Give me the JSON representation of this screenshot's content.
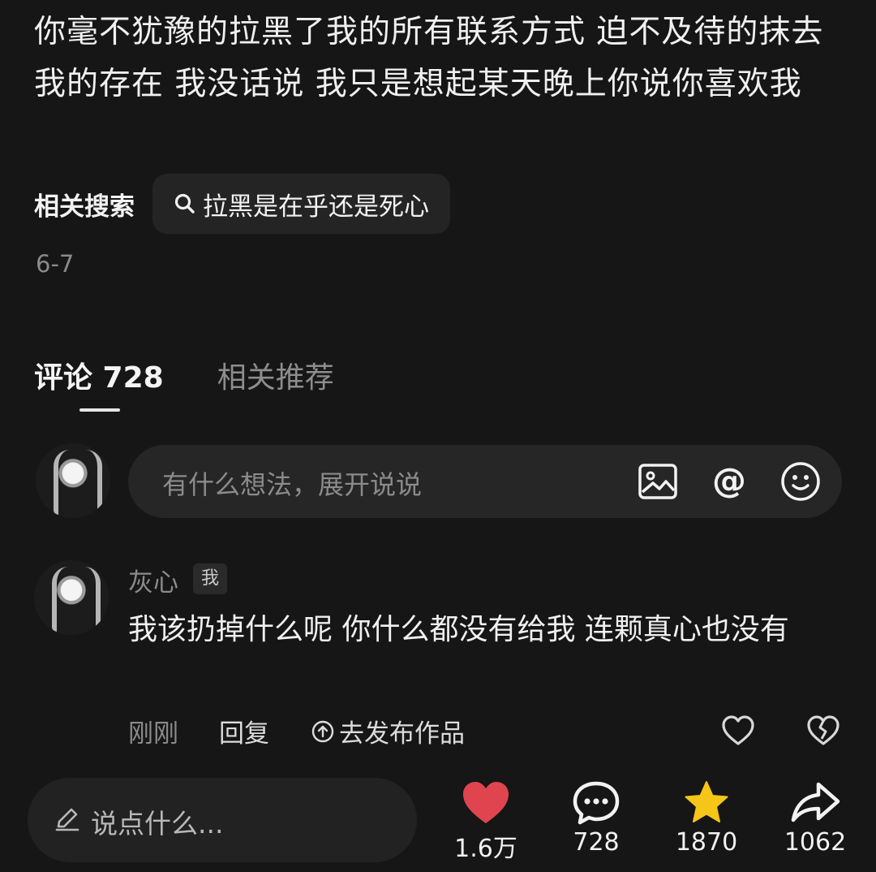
{
  "post": {
    "text": "你毫不犹豫的拉黑了我的所有联系方式 迫不及待的抹去我的存在 我没话说 我只是想起某天晚上你说你喜欢我",
    "related_label": "相关搜索",
    "related_query": "拉黑是在乎还是死心",
    "date": "6-7"
  },
  "tabs": [
    {
      "label": "评论 728"
    },
    {
      "label": "相关推荐"
    }
  ],
  "comment_input": {
    "placeholder": "有什么想法，展开说说",
    "icons": [
      "image-icon",
      "at-icon",
      "emoji-icon"
    ]
  },
  "comment": {
    "author": "灰心",
    "badge": "我",
    "text": "我该扔掉什么呢 你什么都没有给我 连颗真心也没有",
    "time": "刚刚",
    "reply": "回复",
    "publish": "去发布作品"
  },
  "bottom_bar": {
    "placeholder": "说点什么...",
    "like_count": "1.6万",
    "comment_count": "728",
    "favorite_count": "1870",
    "share_count": "1062"
  },
  "colors": {
    "background": "#161616",
    "like": "#e0454f",
    "favorite": "#f5c518"
  }
}
